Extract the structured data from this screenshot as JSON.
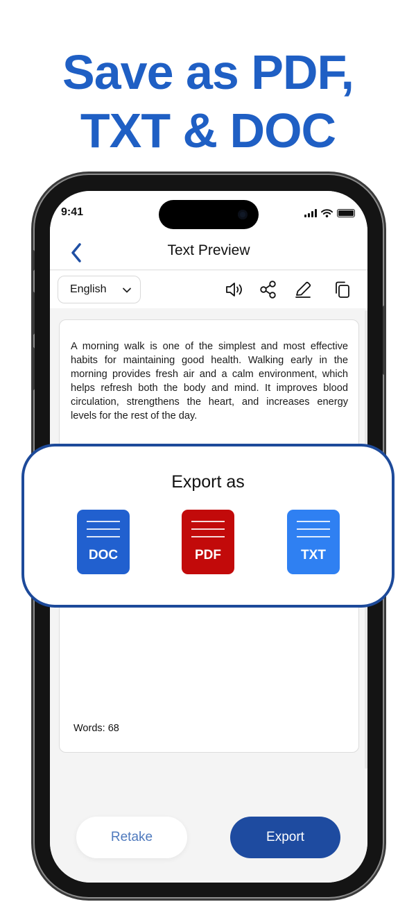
{
  "headline": {
    "line1": "Save as PDF,",
    "line2": "TXT & DOC"
  },
  "status_bar": {
    "time": "9:41"
  },
  "navbar": {
    "title": "Text Preview",
    "back_icon": "chevron-left-icon"
  },
  "toolbar": {
    "language_select": {
      "selected": "English",
      "icon": "chevron-down-icon"
    },
    "actions": [
      "speaker-icon",
      "share-icon",
      "edit-pencil-icon",
      "copy-icon"
    ]
  },
  "document": {
    "text": "A morning walk is one of the simplest and most effective habits for maintaining good health. Walking early in the morning provides fresh air and a calm environment, which helps refresh both the body and mind. It improves blood circulation, strengthens the heart, and increases energy levels for the rest of the day.",
    "word_count_label": "Words: 68"
  },
  "buttons": {
    "retake": "Retake",
    "export": "Export"
  },
  "export_panel": {
    "title": "Export as",
    "formats": [
      {
        "label": "DOC",
        "color": "#2160cf"
      },
      {
        "label": "PDF",
        "color": "#c20a0a"
      },
      {
        "label": "TXT",
        "color": "#2f80f2"
      }
    ]
  },
  "colors": {
    "brand": "#1f5fc4",
    "panel_border": "#1d4a9a",
    "export_button": "#1e4ba0"
  }
}
